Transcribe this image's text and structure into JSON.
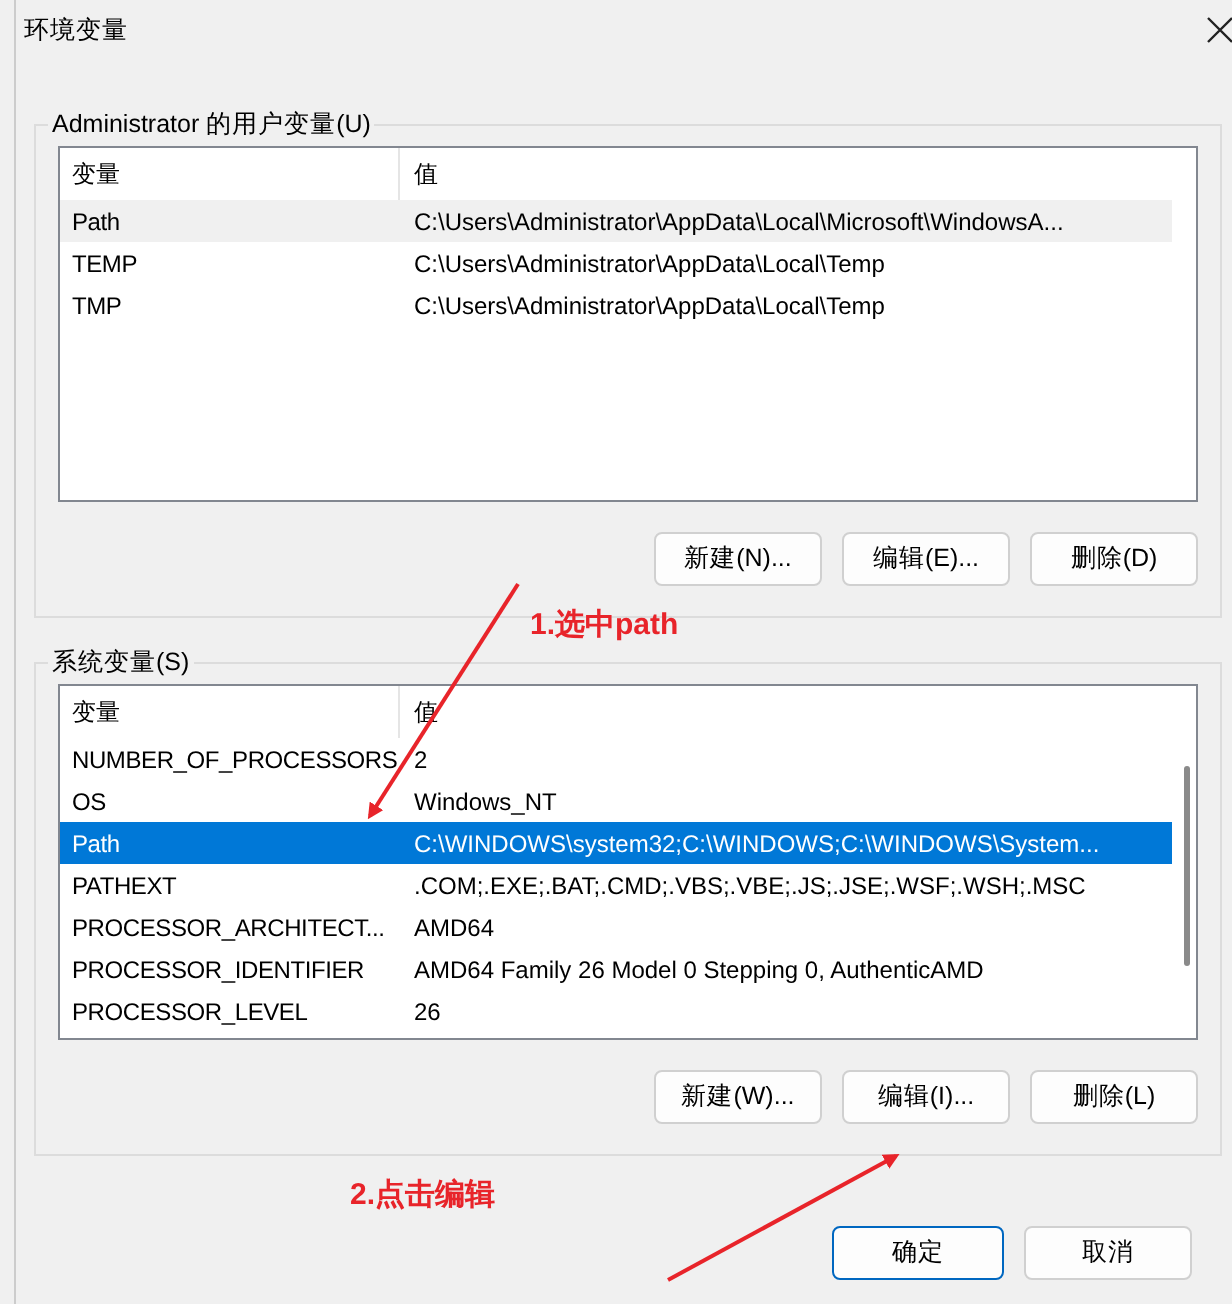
{
  "window": {
    "title": "环境变量"
  },
  "groups": [
    {
      "title": "Administrator 的用户变量(U)",
      "focused": false,
      "columns": [
        "变量",
        "值"
      ],
      "scrollbar": false,
      "rows": [
        {
          "name": "Path",
          "value": "C:\\Users\\Administrator\\AppData\\Local\\Microsoft\\WindowsA...",
          "selected": true
        },
        {
          "name": "TEMP",
          "value": "C:\\Users\\Administrator\\AppData\\Local\\Temp",
          "selected": false
        },
        {
          "name": "TMP",
          "value": "C:\\Users\\Administrator\\AppData\\Local\\Temp",
          "selected": false
        }
      ],
      "buttons": [
        "新建(N)...",
        "编辑(E)...",
        "删除(D)"
      ]
    },
    {
      "title": "系统变量(S)",
      "focused": true,
      "columns": [
        "变量",
        "值"
      ],
      "scrollbar": true,
      "rows": [
        {
          "name": "NUMBER_OF_PROCESSORS",
          "value": "2",
          "selected": false
        },
        {
          "name": "OS",
          "value": "Windows_NT",
          "selected": false
        },
        {
          "name": "Path",
          "value": "C:\\WINDOWS\\system32;C:\\WINDOWS;C:\\WINDOWS\\System...",
          "selected": true
        },
        {
          "name": "PATHEXT",
          "value": ".COM;.EXE;.BAT;.CMD;.VBS;.VBE;.JS;.JSE;.WSF;.WSH;.MSC",
          "selected": false
        },
        {
          "name": "PROCESSOR_ARCHITECT...",
          "value": "AMD64",
          "selected": false
        },
        {
          "name": "PROCESSOR_IDENTIFIER",
          "value": "AMD64 Family 26 Model 0 Stepping 0, AuthenticAMD",
          "selected": false
        },
        {
          "name": "PROCESSOR_LEVEL",
          "value": "26",
          "selected": false
        }
      ],
      "buttons": [
        "新建(W)...",
        "编辑(I)...",
        "删除(L)"
      ]
    }
  ],
  "dialog_buttons": [
    {
      "label": "确定",
      "default": true
    },
    {
      "label": "取消",
      "default": false
    }
  ],
  "annotations": [
    "1.选中path",
    "2.点击编辑"
  ]
}
